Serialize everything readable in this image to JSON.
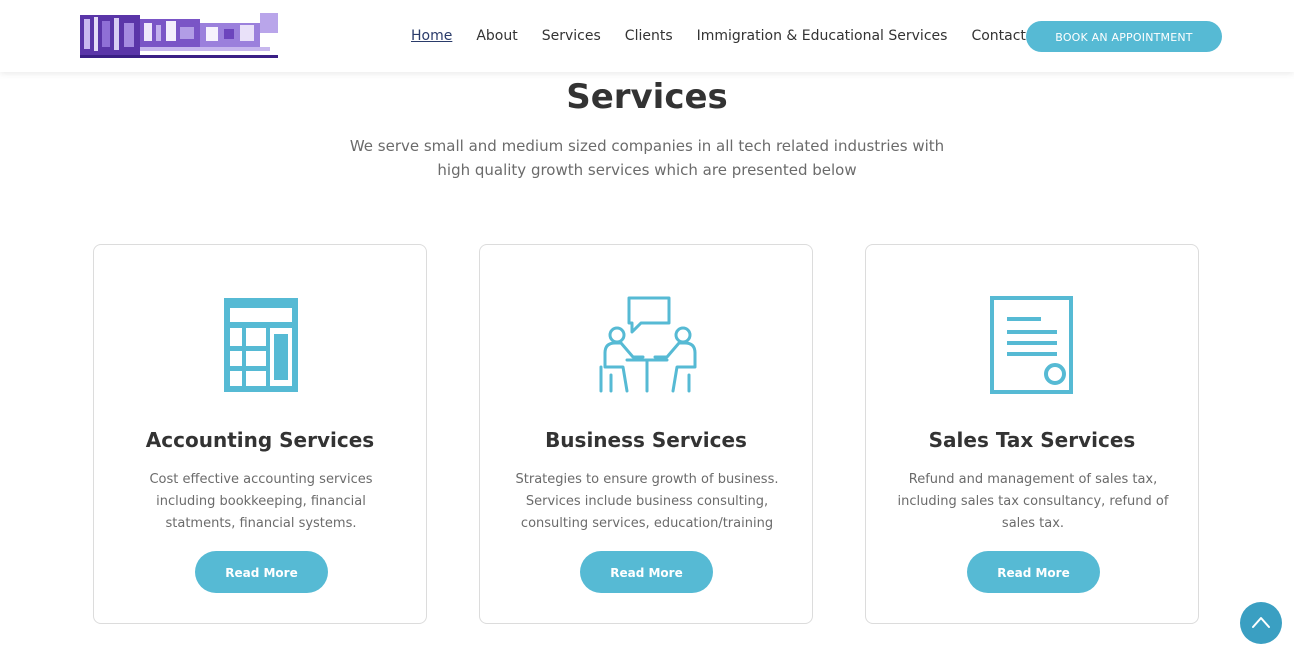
{
  "header": {
    "nav": [
      {
        "label": "Home"
      },
      {
        "label": "About"
      },
      {
        "label": "Services"
      },
      {
        "label": "Clients"
      },
      {
        "label": "Immigration & Educational Services"
      },
      {
        "label": "Contact"
      }
    ],
    "cta_label": "BOOK AN APPOINTMENT"
  },
  "section": {
    "title": "Services",
    "subtitle_line1": "We serve small and medium sized companies in all tech related industries with",
    "subtitle_line2": "high quality growth services which are presented below"
  },
  "cards": [
    {
      "icon": "calculator-icon",
      "title": "Accounting Services",
      "desc_line1": "Cost effective accounting services",
      "desc_line2": "including bookkeeping, financial",
      "desc_line3": "statments, financial systems.",
      "button": "Read More"
    },
    {
      "icon": "meeting-icon",
      "title": "Business Services",
      "desc_line1": "Strategies to ensure growth of business.",
      "desc_line2": "Services include business consulting,",
      "desc_line3": "consulting services, education/training",
      "button": "Read More"
    },
    {
      "icon": "document-icon",
      "title": "Sales Tax Services",
      "desc_line1": "Refund and management of sales tax,",
      "desc_line2": "including sales tax consultancy, refund of",
      "desc_line3": "sales tax.",
      "button": "Read More"
    }
  ],
  "colors": {
    "accent": "#56bad4",
    "back_to_top": "#3a9fc2"
  },
  "icons": {
    "back_to_top": "chevron-up-icon"
  }
}
